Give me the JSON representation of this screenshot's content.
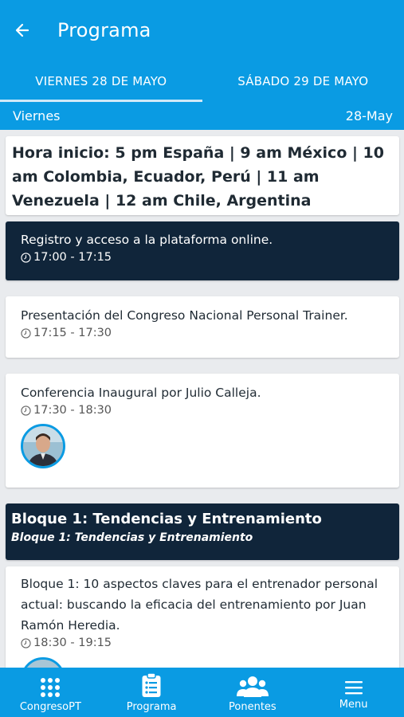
{
  "appbar": {
    "title": "Programa",
    "back_icon": "arrow-left-icon"
  },
  "tabs": [
    {
      "label": "VIERNES 28 DE MAYO",
      "active": true
    },
    {
      "label": "SÁBADO 29 DE MAYO",
      "active": false
    }
  ],
  "subbar": {
    "day": "Viernes",
    "date": "28-May"
  },
  "hora_inicio": "Hora inicio: 5 pm España | 9 am México | 10 am Colombia, Ecuador, Perú | 11 am Venezuela | 12 am Chile, Argentina",
  "events": [
    {
      "title": "Registro y acceso a la plataforma online.",
      "time": "17:00 - 17:15"
    },
    {
      "title": "Presentación del Congreso Nacional Personal Trainer.",
      "time": "17:15 - 17:30"
    },
    {
      "title": "Conferencia Inaugural por Julio Calleja.",
      "time": "17:30 - 18:30"
    },
    {
      "title": "Bloque 1: 10 aspectos claves para el entrenador personal actual: buscando la eficacia del entrenamiento por Juan Ramón Heredia.",
      "time": "18:30 - 19:15"
    }
  ],
  "block": {
    "title": "Bloque 1: Tendencias y Entrenamiento",
    "subtitle": "Bloque 1: Tendencias y Entrenamiento"
  },
  "bottomnav": [
    {
      "label": "CongresoPT",
      "icon": "grid-icon"
    },
    {
      "label": "Programa",
      "icon": "clipboard-icon"
    },
    {
      "label": "Ponentes",
      "icon": "people-icon"
    },
    {
      "label": "Menu",
      "icon": "menu-icon"
    }
  ],
  "colors": {
    "primary": "#0a9be3",
    "dark": "#10253a",
    "background": "#e9ebee"
  }
}
